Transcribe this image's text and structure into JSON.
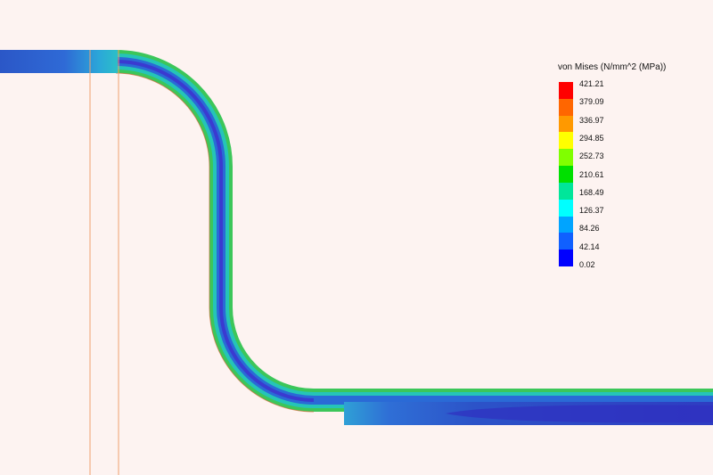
{
  "legend": {
    "title": "von Mises (N/mm^2 (MPa))",
    "levels": [
      "421.21",
      "379.09",
      "336.97",
      "294.85",
      "252.73",
      "210.61",
      "168.49",
      "126.37",
      "84.26",
      "42.14",
      "0.02"
    ],
    "colors": [
      "#ff0000",
      "#ff6600",
      "#ff9900",
      "#ffff00",
      "#80ff00",
      "#00e000",
      "#00e69a",
      "#00ffff",
      "#00a4ff",
      "#1060ff",
      "#0000ff"
    ]
  },
  "palette": {
    "background": "#fdf3f1",
    "pipe_low": "#3b3bd0",
    "pipe_mid": "#1a7ad9",
    "pipe_cyan": "#20c0c0",
    "pipe_green": "#3ad35a",
    "guide_line": "#f0a070"
  }
}
